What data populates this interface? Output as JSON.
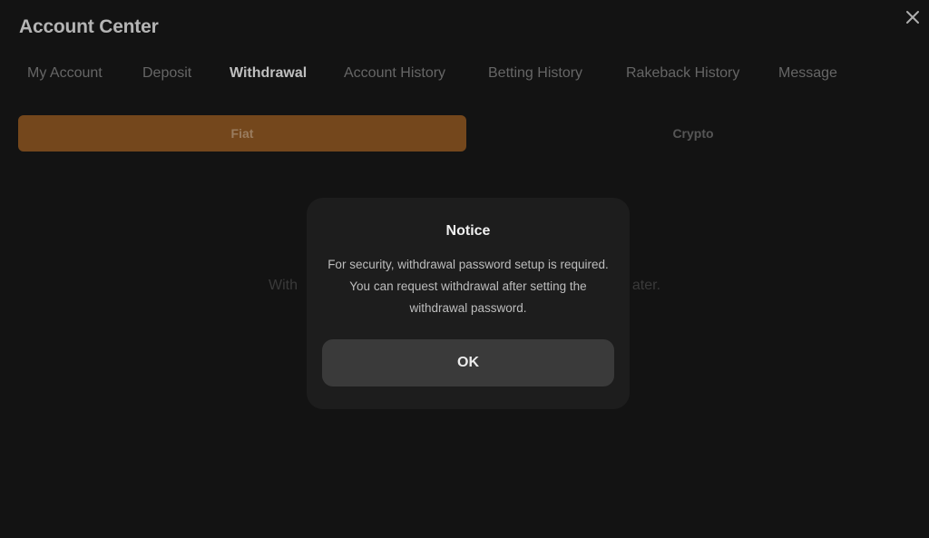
{
  "header": {
    "title": "Account Center",
    "close_icon": "close-icon"
  },
  "tabs": [
    {
      "label": "My Account",
      "active": false
    },
    {
      "label": "Deposit",
      "active": false
    },
    {
      "label": "Withdrawal",
      "active": true
    },
    {
      "label": "Account History",
      "active": false
    },
    {
      "label": "Betting History",
      "active": false
    },
    {
      "label": "Rakeback History",
      "active": false
    },
    {
      "label": "Message",
      "active": false
    }
  ],
  "withdraw_type": {
    "options": [
      "Fiat",
      "Crypto"
    ],
    "selected": "Fiat"
  },
  "background_message": {
    "left_visible": "With",
    "right_visible": "ater."
  },
  "modal": {
    "title": "Notice",
    "body": "For security, withdrawal password setup is required. You can request withdrawal after setting the withdrawal password.",
    "ok_label": "OK"
  },
  "colors": {
    "background": "#151515",
    "accent": "#7e4e1f",
    "modal_bg": "#1d1d1d",
    "button_bg": "#3a3a3a"
  }
}
